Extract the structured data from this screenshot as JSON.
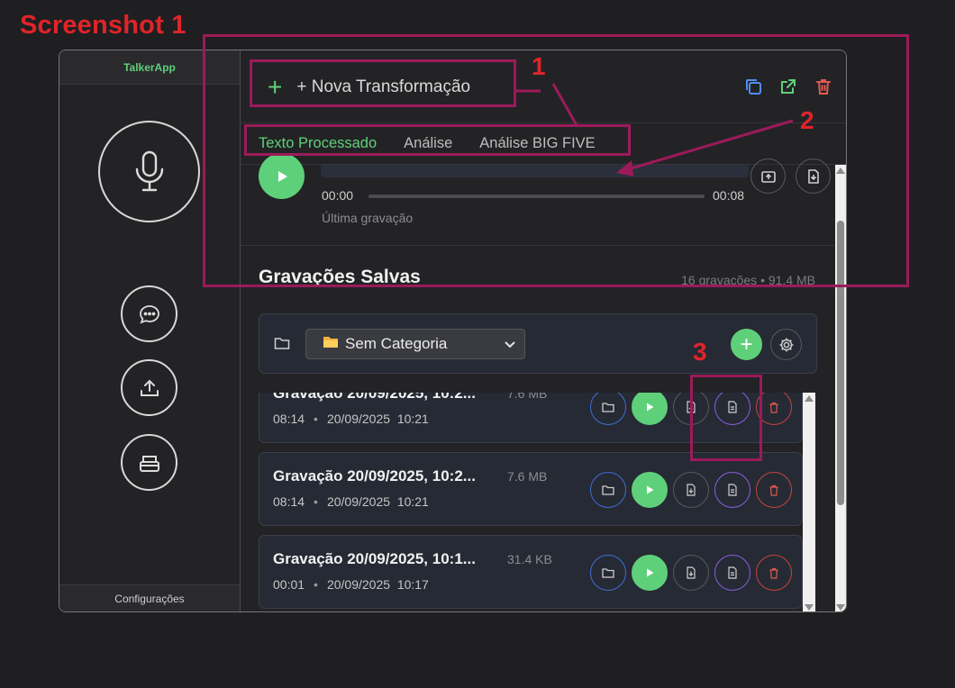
{
  "caption": "Screenshot 1",
  "app": {
    "name": "TalkerApp"
  },
  "sidebar": {
    "footer_label": "Configurações"
  },
  "toolbar": {
    "new_transformation_label": "+ Nova Transformação"
  },
  "tabs": [
    {
      "label": "Texto Processado",
      "active": true
    },
    {
      "label": "Análise"
    },
    {
      "label": "Análise BIG FIVE"
    }
  ],
  "player": {
    "current_time": "00:00",
    "total_time": "00:08",
    "caption": "Última gravação"
  },
  "saved": {
    "title": "Gravações Salvas",
    "info": "16 gravações • 91.4 MB"
  },
  "category": {
    "selected": "Sem Categoria"
  },
  "recordings": [
    {
      "title": "Gravação 20/09/2025, 10:2...",
      "size": "7.6 MB",
      "duration": "08:14",
      "date": "20/09/2025",
      "time": "10:21"
    },
    {
      "title": "Gravação 20/09/2025, 10:2...",
      "size": "7.6 MB",
      "duration": "08:14",
      "date": "20/09/2025",
      "time": "10:21"
    },
    {
      "title": "Gravação 20/09/2025, 10:1...",
      "size": "31.4 KB",
      "duration": "00:01",
      "date": "20/09/2025",
      "time": "10:17"
    }
  ],
  "annotations": {
    "one": "1",
    "two": "2",
    "three": "3"
  },
  "colors": {
    "accent_green": "#5fd07a",
    "annotation_red": "#e0242a",
    "annotation_box": "#9c1a5a"
  }
}
